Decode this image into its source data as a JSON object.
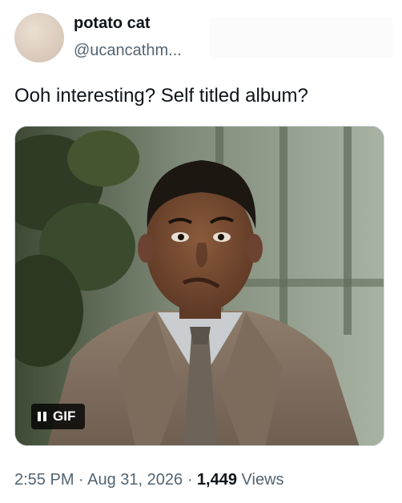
{
  "author": {
    "display_name": "potato cat",
    "handle": "@ucancathm..."
  },
  "tweet": {
    "text": "Ooh interesting? Self titled album?"
  },
  "media": {
    "type": "gif",
    "badge_label": "GIF",
    "icon": "pause-icon"
  },
  "meta": {
    "time": "2:55 PM",
    "separator1": " · ",
    "date": "Aug 31, 2026",
    "separator2": " · ",
    "views_count": "1,449",
    "views_label": " Views"
  }
}
